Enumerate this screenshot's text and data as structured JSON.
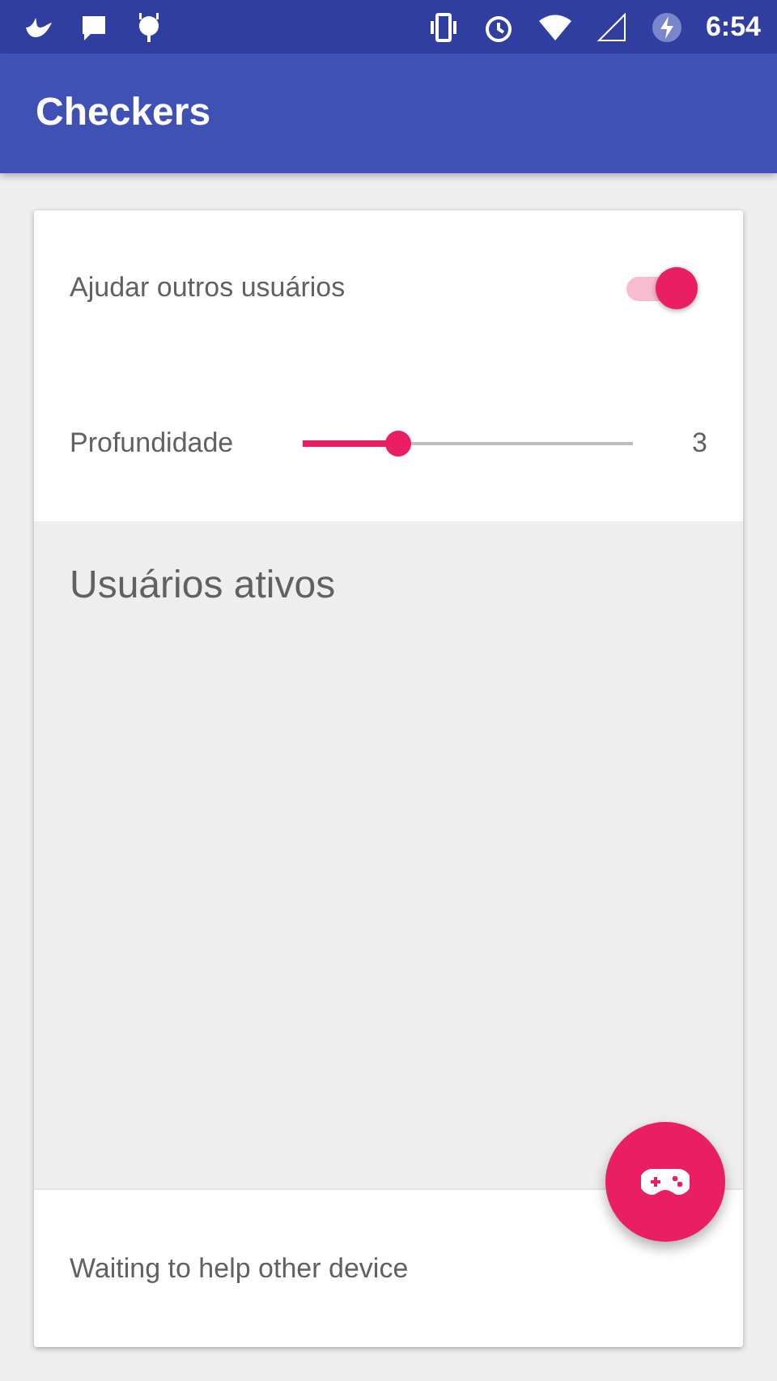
{
  "status_bar": {
    "time": "6:54"
  },
  "app_bar": {
    "title": "Checkers"
  },
  "settings": {
    "help_others": {
      "label": "Ajudar outros usuários",
      "on": true
    },
    "depth": {
      "label": "Profundidade",
      "level": 0.29,
      "reading": "3"
    }
  },
  "active_users": {
    "title": "Usuários ativos"
  },
  "footer": {
    "status": "Waiting to help other device"
  }
}
